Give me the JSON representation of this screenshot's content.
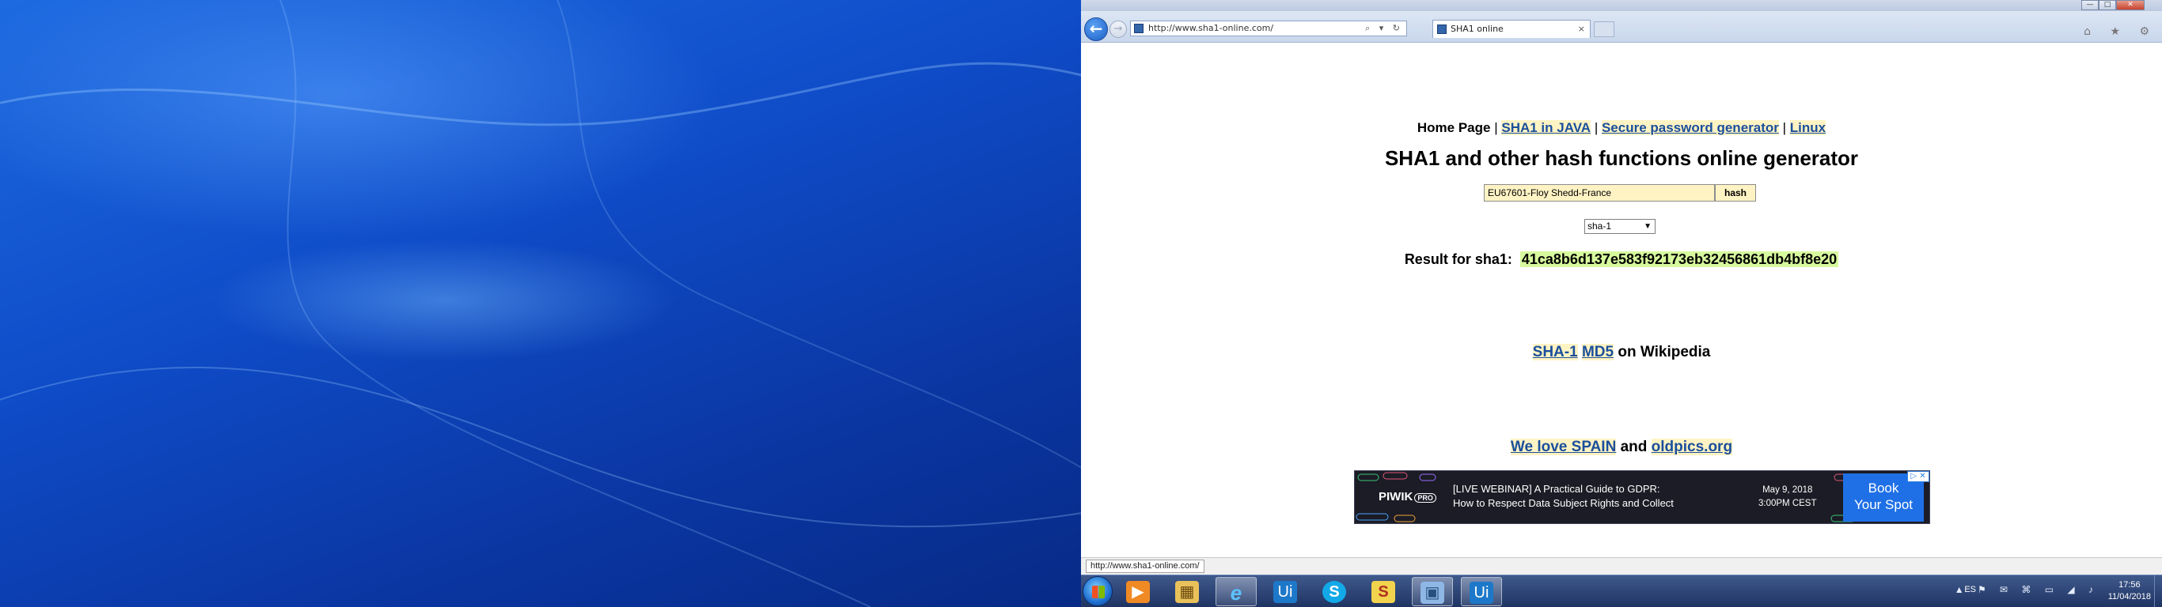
{
  "browser": {
    "address_url": "http://www.sha1-online.com/",
    "tab_title": "SHA1 online",
    "tab_close": "×",
    "back_glyph": "←",
    "forward_glyph": "→",
    "address_controls": "⌕ ▾ ↻",
    "tool_icons": "⌂ ★ ⚙",
    "caption_min": "—",
    "caption_max": "□",
    "caption_close": "✕"
  },
  "page": {
    "nav_home": "Home Page",
    "nav_sep": " | ",
    "nav_links": [
      "SHA1 in JAVA",
      "Secure password generator",
      "Linux"
    ],
    "title": "SHA1 and other hash functions online generator",
    "input_value": "EU67601-Floy Shedd-France",
    "hash_button": "hash",
    "algorithm_selected": "sha-1",
    "result_label": "Result for sha1:",
    "result_hash": "41ca8b6d137e583f92173eb32456861db4bf8e20",
    "wiki_link1": "SHA-1",
    "wiki_link2": "MD5",
    "wiki_suffix": "on Wikipedia",
    "love_link1": "We love SPAIN",
    "love_and": "and",
    "love_link2": "oldpics.org"
  },
  "ad": {
    "brand": "PIWIK",
    "brand_badge": "PRO",
    "line1": "[LIVE WEBINAR] A Practical Guide to GDPR:",
    "line2": "How to Respect Data Subject Rights and Collect",
    "date_line1": "May 9, 2018",
    "date_line2": "3:00PM CEST",
    "cta_line1": "Book",
    "cta_line2": "Your Spot",
    "choice": "▷ ✕"
  },
  "statusbar": {
    "hover_url": "http://www.sha1-online.com/"
  },
  "taskbar": {
    "apps": [
      {
        "name": "media-player",
        "glyph": "▶"
      },
      {
        "name": "explorer",
        "glyph": "▦"
      },
      {
        "name": "internet-explorer",
        "glyph": "e"
      },
      {
        "name": "uipath-1",
        "glyph": "Ui"
      },
      {
        "name": "skype",
        "glyph": "S"
      },
      {
        "name": "stickies",
        "glyph": "S"
      },
      {
        "name": "control-panel",
        "glyph": "▣"
      },
      {
        "name": "uipath-2",
        "glyph": "Ui"
      }
    ],
    "language": "ES",
    "tray_icons": "▲ ⚑ ✉ ⌘ ▭ ◢ ♪",
    "time": "17:56",
    "date": "11/04/2018"
  },
  "colors": {
    "link": "#1a4f9c",
    "link_bg": "#fff3c4",
    "result_bg": "#d7f99d",
    "ad_cta": "#1f70e6"
  }
}
